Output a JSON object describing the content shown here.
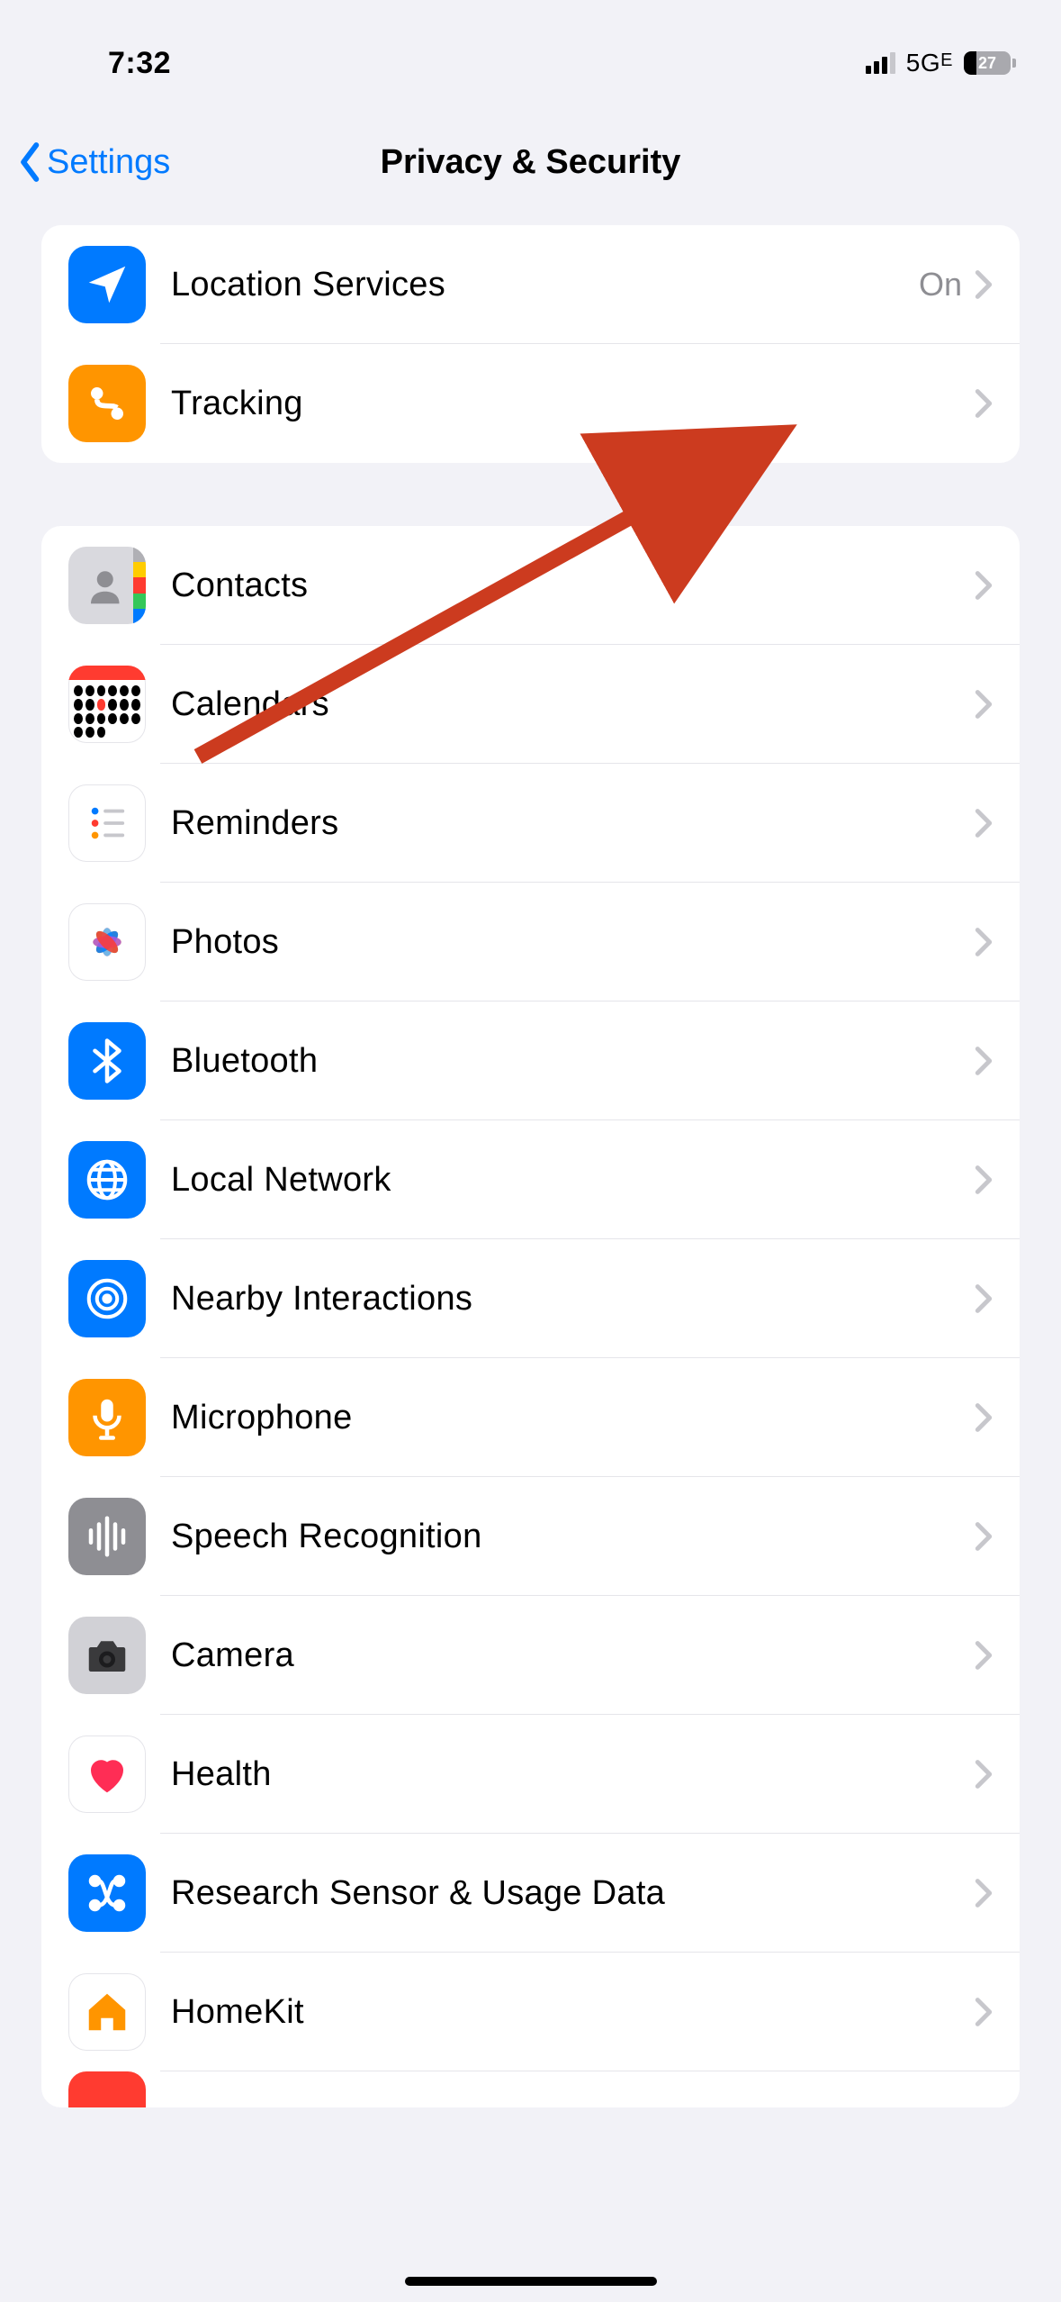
{
  "status": {
    "time": "7:32",
    "network": "5G",
    "network_suffix": "E",
    "battery_pct": "27"
  },
  "nav": {
    "back_label": "Settings",
    "title": "Privacy & Security"
  },
  "group1": {
    "items": [
      {
        "label": "Location Services",
        "value": "On"
      },
      {
        "label": "Tracking"
      }
    ]
  },
  "group2": {
    "items": [
      {
        "label": "Contacts"
      },
      {
        "label": "Calendars"
      },
      {
        "label": "Reminders"
      },
      {
        "label": "Photos"
      },
      {
        "label": "Bluetooth"
      },
      {
        "label": "Local Network"
      },
      {
        "label": "Nearby Interactions"
      },
      {
        "label": "Microphone"
      },
      {
        "label": "Speech Recognition"
      },
      {
        "label": "Camera"
      },
      {
        "label": "Health"
      },
      {
        "label": "Research Sensor & Usage Data"
      },
      {
        "label": "HomeKit"
      }
    ]
  }
}
